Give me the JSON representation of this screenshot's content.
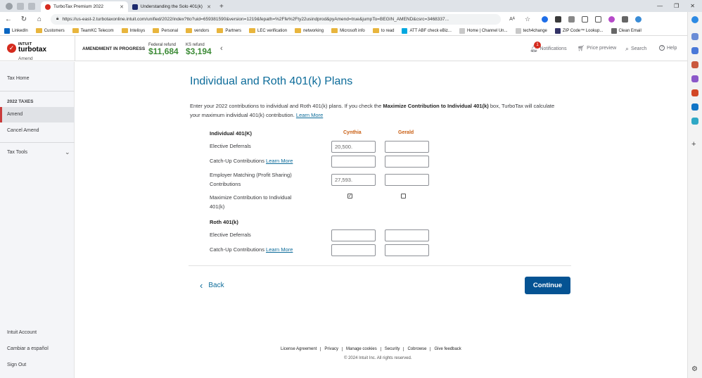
{
  "browser": {
    "tabs": [
      {
        "label": "TurboTax Premium 2022",
        "active": true,
        "icon_color": "#d52b1e"
      },
      {
        "label": "Understanding the Solo 401(k) II",
        "active": false,
        "icon_color": "#1d2b6e"
      }
    ],
    "url": "https://us-east-2.turbotaxonline.intuit.com/unified/2022/index?tto?uid=659381590&version=1219&fepath=%2Ffe%2Fty22usindprod&pyAmend=true&jumpTo=BEGIN_AMEND&csrc=3468337...",
    "bookmarks": [
      {
        "label": "LinkedIn",
        "icon": "linkedin-icon"
      },
      {
        "label": "Customers",
        "icon": "folder-icon"
      },
      {
        "label": "TeamKC Telecom",
        "icon": "folder-icon"
      },
      {
        "label": "Intelisys",
        "icon": "folder-icon"
      },
      {
        "label": "Personal",
        "icon": "folder-icon"
      },
      {
        "label": "vendors",
        "icon": "folder-icon"
      },
      {
        "label": "Partners",
        "icon": "folder-icon"
      },
      {
        "label": "LEC verification",
        "icon": "folder-icon"
      },
      {
        "label": "networking",
        "icon": "folder-icon"
      },
      {
        "label": "Microsoft info",
        "icon": "folder-icon"
      },
      {
        "label": "to read",
        "icon": "folder-icon"
      },
      {
        "label": "ATT ABF check eBiz...",
        "icon": "att-icon"
      },
      {
        "label": "Home | Channel Un...",
        "icon": "page-icon"
      },
      {
        "label": "tech4change",
        "icon": "page-icon"
      },
      {
        "label": "ZIP Code™ Lookup...",
        "icon": "usps-icon"
      },
      {
        "label": "Clean Email",
        "icon": "email-icon"
      }
    ]
  },
  "header": {
    "logo_top": "INTUIT",
    "logo_main": "turbotax",
    "logo_sub": "Amend",
    "amendment_status": "AMENDMENT IN PROGRESS",
    "federal_label": "Federal refund",
    "federal_value": "$11,684",
    "ks_label": "KS refund",
    "ks_value": "$3,194",
    "notifications_label": "Notifications",
    "notifications_count": "1",
    "price_preview_label": "Price preview",
    "search_label": "Search",
    "help_label": "Help"
  },
  "sidebar": {
    "tax_home": "Tax Home",
    "section": "2022 TAXES",
    "amend": "Amend",
    "cancel_amend": "Cancel Amend",
    "tax_tools": "Tax Tools",
    "intuit_account": "Intuit Account",
    "spanish": "Cambiar a español",
    "sign_out": "Sign Out"
  },
  "main": {
    "title": "Individual and Roth 401(k) Plans",
    "intro_1": "Enter your 2022 contributions to individual and Roth 401(k) plans. If you check the ",
    "intro_bold": "Maximize Contribution to Individual 401(k)",
    "intro_2": " box, TurboTax will calculate your maximum individual 401(k) contribution. ",
    "intro_link": "Learn More",
    "individual_heading": "Individual 401(K)",
    "col_person1": "Cynthia",
    "col_person2": "Gerald",
    "rows_individual": {
      "elective_label": "Elective Deferrals",
      "elective_p1": "20,500.",
      "elective_p2": "",
      "catchup_label": "Catch-Up Contributions ",
      "catchup_link": "Learn More",
      "catchup_p1": "",
      "catchup_p2": "",
      "employer_label_1": "Employer Matching (Profit Sharing)",
      "employer_label_2": "Contributions",
      "employer_p1": "27,593.",
      "employer_p2": "",
      "maximize_label_1": "Maximize Contribution to Individual",
      "maximize_label_2": "401(k)",
      "maximize_p1_checked": true,
      "maximize_p2_checked": false
    },
    "roth_heading": "Roth 401(k)",
    "rows_roth": {
      "elective_label": "Elective Deferrals",
      "elective_p1": "",
      "elective_p2": "",
      "catchup_label": "Catch-Up Contributions ",
      "catchup_link": "Learn More",
      "catchup_p1": "",
      "catchup_p2": ""
    },
    "back_label": "Back",
    "continue_label": "Continue"
  },
  "footer": {
    "links": [
      "License Agreement",
      "Privacy",
      "Manage cookies",
      "Security",
      "Cobrowse",
      "Give feedback"
    ],
    "copyright": "© 2024 Intuit Inc. All rights reserved."
  },
  "colors": {
    "brand_red": "#d52b1e",
    "link_blue": "#0d6c9a",
    "refund_green": "#3d8b37",
    "button_blue": "#055393",
    "column_orange": "#c95e12"
  }
}
